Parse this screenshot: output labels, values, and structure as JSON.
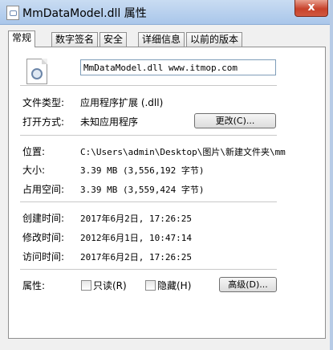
{
  "window": {
    "title": "MmDataModel.dll 属性",
    "close_label": "x"
  },
  "tabs": [
    "常规",
    "数字签名",
    "安全",
    "详细信息",
    "以前的版本"
  ],
  "general": {
    "filename": "MmDataModel.dll www.itmop.com",
    "type_label": "文件类型:",
    "type_value": "应用程序扩展 (.dll)",
    "open_label": "打开方式:",
    "open_value": "未知应用程序",
    "change_button": "更改(C)...",
    "location_label": "位置:",
    "location_value": "C:\\Users\\admin\\Desktop\\图片\\新建文件夹\\mm",
    "size_label": "大小:",
    "size_value": "3.39 MB (3,556,192 字节)",
    "disk_label": "占用空间:",
    "disk_value": "3.39 MB (3,559,424 字节)",
    "created_label": "创建时间:",
    "created_value": "2017年6月2日, 17:26:25",
    "modified_label": "修改时间:",
    "modified_value": "2012年6月1日, 10:47:14",
    "accessed_label": "访问时间:",
    "accessed_value": "2017年6月2日, 17:26:25",
    "attributes_label": "属性:",
    "readonly_label": "只读(R)",
    "hidden_label": "隐藏(H)",
    "advanced_button": "高级(D)..."
  }
}
